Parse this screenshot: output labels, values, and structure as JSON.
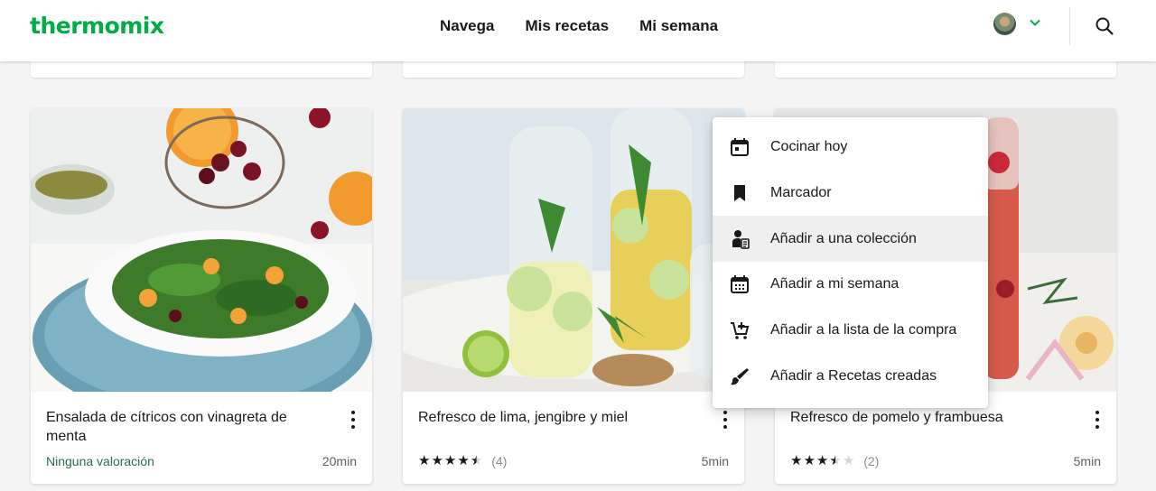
{
  "brand": {
    "logo": "thermomix",
    "accent": "#00ac46"
  },
  "nav": {
    "items": [
      "Navega",
      "Mis recetas",
      "Mi semana"
    ]
  },
  "header_icons": {
    "avatar": "user-avatar",
    "chevron": "chevron-down-icon",
    "search": "search-icon"
  },
  "cards": [
    {
      "title": "Ensalada de cítricos con vinagreta de menta",
      "rating_text": "Ninguna valoración",
      "time": "20min"
    },
    {
      "title": "Refresco de lima, jengibre y miel",
      "stars": 4.5,
      "rating_count": "(4)",
      "time": "5min"
    },
    {
      "title": "Refresco de pomelo y frambuesa",
      "stars": 3.5,
      "rating_count": "(2)",
      "time": "5min"
    }
  ],
  "context_menu": {
    "items": [
      {
        "label": "Cocinar hoy",
        "icon": "calendar-today-icon"
      },
      {
        "label": "Marcador",
        "icon": "bookmark-icon"
      },
      {
        "label": "Añadir a una colección",
        "icon": "add-to-collection-icon",
        "highlighted": true
      },
      {
        "label": "Añadir a mi semana",
        "icon": "calendar-week-icon"
      },
      {
        "label": "Añadir a la lista de la compra",
        "icon": "add-to-cart-icon"
      },
      {
        "label": "Añadir a Recetas creadas",
        "icon": "brush-icon"
      }
    ]
  }
}
